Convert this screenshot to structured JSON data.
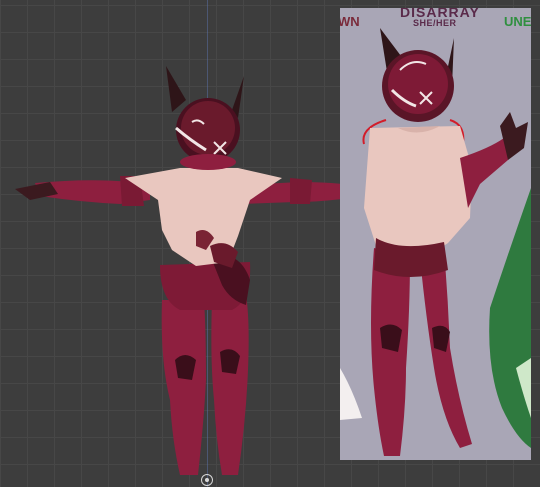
{
  "viewport": {
    "background": "#3d3d3d",
    "grid_color": "#474747"
  },
  "reference": {
    "name": "DISARRAY",
    "pronouns": "SHE/HER",
    "left_cut_text": "WN",
    "right_cut_text": "UNE",
    "background": "#a9a6b6"
  },
  "colors": {
    "body": "#8e1f3f",
    "body_dark": "#5a1527",
    "shirt": "#e9c7bf",
    "helmet": "#4a1020",
    "ears": "#3a1a1e",
    "green_character": "#2f7a3f"
  },
  "icons": {
    "origin": "origin-marker-icon"
  }
}
